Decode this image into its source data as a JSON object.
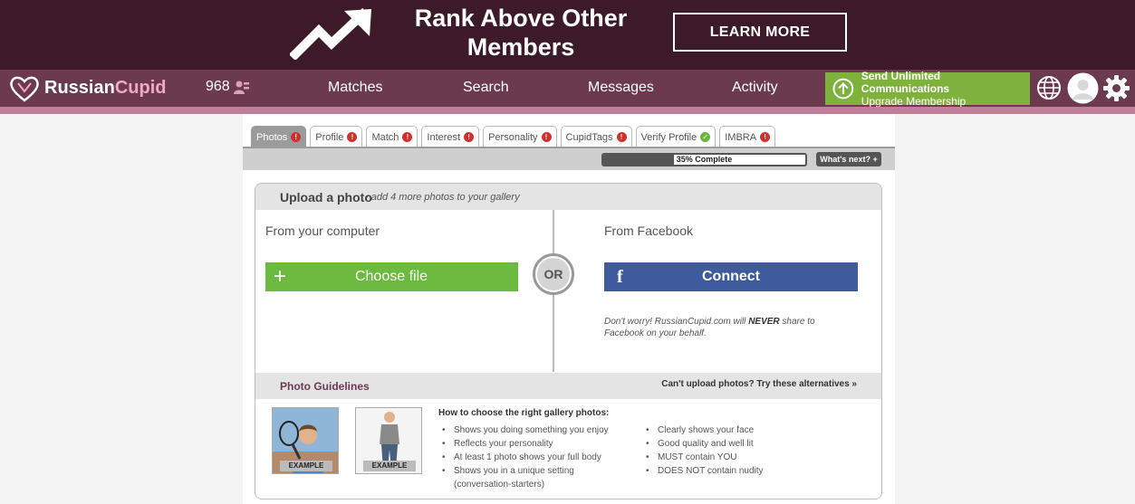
{
  "banner": {
    "headline": "Rank Above Other Members",
    "cta": "LEARN MORE"
  },
  "nav": {
    "brand_part1": "Russian",
    "brand_part2": "Cupid",
    "count": "968",
    "links": [
      "Matches",
      "Search",
      "Messages",
      "Activity"
    ],
    "upgrade_line1": "Send Unlimited Communications",
    "upgrade_line2": "Upgrade Membership"
  },
  "tabs": [
    {
      "label": "Photos",
      "status": "!"
    },
    {
      "label": "Profile",
      "status": "!"
    },
    {
      "label": "Match",
      "status": "!"
    },
    {
      "label": "Interest",
      "status": "!"
    },
    {
      "label": "Personality",
      "status": "!"
    },
    {
      "label": "CupidTags",
      "status": "!"
    },
    {
      "label": "Verify Profile",
      "status": "✓"
    },
    {
      "label": "IMBRA",
      "status": "!"
    }
  ],
  "progress": {
    "percent": 35,
    "label": "35% Complete",
    "next": "What's next? +"
  },
  "upload": {
    "title": "Upload a photo",
    "subtitle": "- add 4 more photos to your gallery",
    "computer_label": "From your computer",
    "choose_plus": "+",
    "choose_label": "Choose file",
    "or": "OR",
    "facebook_label": "From Facebook",
    "fb_glyph": "f",
    "connect_label": "Connect",
    "note_pre": "Don't worry! RussianCupid.com will ",
    "note_bold": "NEVER",
    "note_post": " share to Facebook on your behalf."
  },
  "guidelines": {
    "title": "Photo Guidelines",
    "alternatives": "Can't upload photos? Try these alternatives »",
    "example_label": "EXAMPLE",
    "how_title": "How to choose the right gallery photos:",
    "tips_left": [
      "Shows you doing something you enjoy",
      "Reflects your personality",
      "At least 1 photo shows your full body",
      "Shows you in a unique setting (conversation-starters)"
    ],
    "tips_right": [
      "Clearly shows your face",
      "Good quality and well lit",
      "MUST contain YOU",
      "DOES NOT contain nudity"
    ]
  },
  "colors": {
    "banner_bg": "#3d1a27",
    "nav_bg": "#6c3a4f",
    "accent_pink": "#c07f98",
    "upgrade_green": "#7fb23d",
    "choose_green": "#6cba3f",
    "facebook_blue": "#3f5b9d"
  }
}
